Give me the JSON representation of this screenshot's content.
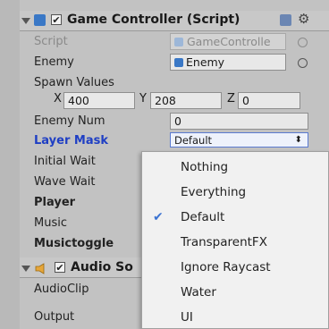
{
  "game_controller": {
    "title": "Game Controller (Script)",
    "fields": {
      "script": {
        "label": "Script",
        "value": "GameControlle"
      },
      "enemy": {
        "label": "Enemy",
        "value": "Enemy"
      },
      "spawn_values": {
        "label": "Spawn Values",
        "x_label": "X",
        "x": "400",
        "y_label": "Y",
        "y": "208",
        "z_label": "Z",
        "z": "0"
      },
      "enemy_num": {
        "label": "Enemy Num",
        "value": "0"
      },
      "layer_mask": {
        "label": "Layer Mask",
        "value": "Default"
      },
      "initial_wait": {
        "label": "Initial Wait"
      },
      "wave_wait": {
        "label": "Wave Wait"
      },
      "player": {
        "label": "Player"
      },
      "music": {
        "label": "Music"
      },
      "musictoggle": {
        "label": "Musictoggle"
      }
    }
  },
  "audio_source": {
    "title": "Audio So",
    "fields": {
      "audioclip": {
        "label": "AudioClip"
      },
      "output": {
        "label": "Output"
      }
    }
  },
  "layer_menu": {
    "items": [
      {
        "label": "Nothing",
        "checked": false
      },
      {
        "label": "Everything",
        "checked": false
      },
      {
        "label": "Default",
        "checked": true
      },
      {
        "label": "TransparentFX",
        "checked": false
      },
      {
        "label": "Ignore Raycast",
        "checked": false
      },
      {
        "label": "Water",
        "checked": false
      },
      {
        "label": "UI",
        "checked": false
      }
    ]
  },
  "icons": {
    "checkmark": "✔",
    "dropdown_arrow": "⬍"
  },
  "colors": {
    "panel_bg": "#c2c2c2",
    "blue_label": "#1f3fc4",
    "menu_bg": "#f1f1f1",
    "check": "#3b73d2",
    "script_icon": "#3a78c6",
    "audio_icon": "#e6a63a"
  }
}
